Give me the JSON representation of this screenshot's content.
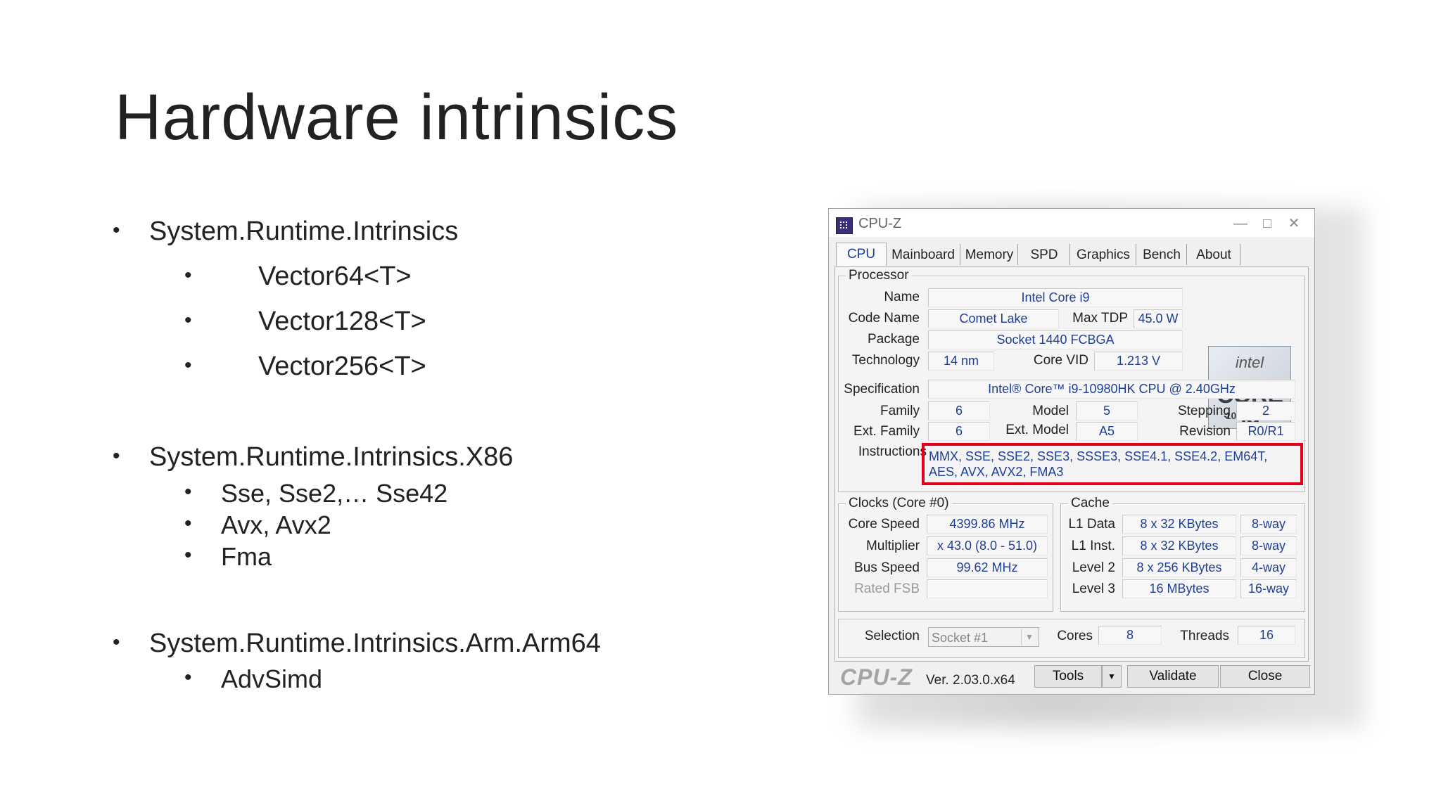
{
  "slide": {
    "title": "Hardware intrinsics",
    "bullets": [
      {
        "text": "System.Runtime.Intrinsics",
        "children": [
          "Vector64<T>",
          "Vector128<T>",
          "Vector256<T>"
        ]
      },
      {
        "text": "System.Runtime.Intrinsics.X86",
        "children": [
          "Sse, Sse2,… Sse42",
          "Avx, Avx2",
          "Fma"
        ]
      },
      {
        "text": "System.Runtime.Intrinsics.Arm.Arm64",
        "children": [
          "AdvSimd"
        ]
      }
    ]
  },
  "window": {
    "title": "CPU-Z",
    "minimize_glyph": "—",
    "maximize_glyph": "□",
    "close_glyph": "✕",
    "tabs": [
      "CPU",
      "Mainboard",
      "Memory",
      "SPD",
      "Graphics",
      "Bench",
      "About"
    ],
    "active_tab": "CPU",
    "processor": {
      "group_label": "Processor",
      "name_label": "Name",
      "name": "Intel Core i9",
      "codename_label": "Code Name",
      "codename": "Comet Lake",
      "maxtdp_label": "Max TDP",
      "maxtdp": "45.0 W",
      "package_label": "Package",
      "package": "Socket 1440 FCBGA",
      "technology_label": "Technology",
      "technology": "14 nm",
      "corevid_label": "Core VID",
      "corevid": "1.213 V",
      "spec_label": "Specification",
      "spec": "Intel® Core™ i9-10980HK CPU @ 2.40GHz",
      "family_label": "Family",
      "family": "6",
      "model_label": "Model",
      "model": "5",
      "stepping_label": "Stepping",
      "stepping": "2",
      "extfamily_label": "Ext. Family",
      "extfamily": "6",
      "extmodel_label": "Ext. Model",
      "extmodel": "A5",
      "revision_label": "Revision",
      "revision": "R0/R1",
      "instructions_label": "Instructions",
      "instructions": "MMX, SSE, SSE2, SSE3, SSSE3, SSE4.1, SSE4.2, EM64T, AES, AVX, AVX2, FMA3",
      "logo": {
        "brand": "intel",
        "line": "CORE i9",
        "gen": "10TH GEN"
      }
    },
    "clocks": {
      "group_label": "Clocks (Core #0)",
      "corespeed_label": "Core Speed",
      "corespeed": "4399.86 MHz",
      "multiplier_label": "Multiplier",
      "multiplier": "x 43.0 (8.0 - 51.0)",
      "busspeed_label": "Bus Speed",
      "busspeed": "99.62 MHz",
      "ratedfsb_label": "Rated FSB",
      "ratedfsb": ""
    },
    "cache": {
      "group_label": "Cache",
      "rows": [
        {
          "label": "L1 Data",
          "size": "8 x 32 KBytes",
          "way": "8-way"
        },
        {
          "label": "L1 Inst.",
          "size": "8 x 32 KBytes",
          "way": "8-way"
        },
        {
          "label": "Level 2",
          "size": "8 x 256 KBytes",
          "way": "4-way"
        },
        {
          "label": "Level 3",
          "size": "16 MBytes",
          "way": "16-way"
        }
      ]
    },
    "selection": {
      "label": "Selection",
      "value": "Socket #1",
      "cores_label": "Cores",
      "cores": "8",
      "threads_label": "Threads",
      "threads": "16"
    },
    "footer": {
      "logo": "CPU-Z",
      "version": "Ver. 2.03.0.x64",
      "tools": "Tools",
      "tools_arrow": "▼",
      "validate": "Validate",
      "close": "Close"
    }
  },
  "colors": {
    "value_text": "#1f3e96",
    "highlight": "#e2001a",
    "active_tab": "#1a3e9a"
  }
}
